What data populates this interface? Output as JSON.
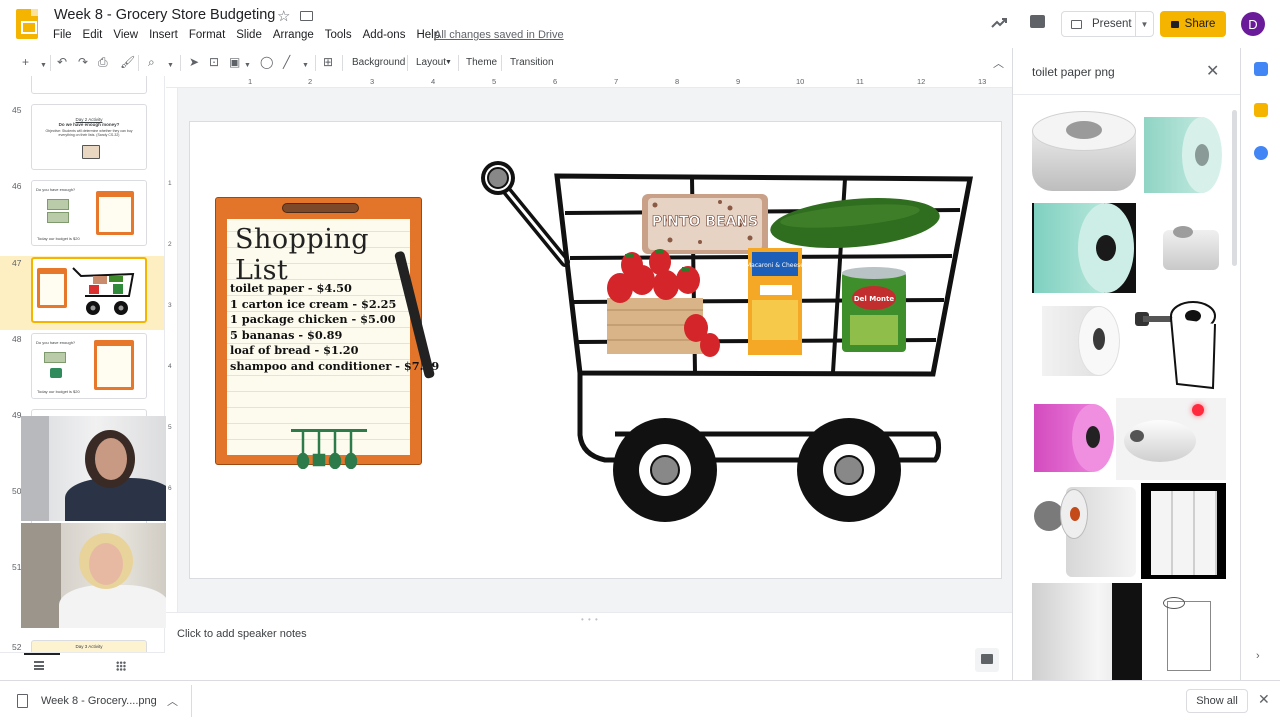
{
  "doc": {
    "title": "Week 8 - Grocery Store Budgeting",
    "saved_status": "All changes saved in Drive",
    "menus": [
      "File",
      "Edit",
      "View",
      "Insert",
      "Format",
      "Slide",
      "Arrange",
      "Tools",
      "Add-ons",
      "Help"
    ]
  },
  "header": {
    "present_label": "Present",
    "share_label": "Share",
    "avatar_letter": "D"
  },
  "toolbar": {
    "background_label": "Background",
    "layout_label": "Layout",
    "theme_label": "Theme",
    "transition_label": "Transition"
  },
  "ruler": {
    "top": [
      "1",
      "2",
      "3",
      "4",
      "5",
      "6",
      "7",
      "8",
      "9",
      "10",
      "11",
      "12",
      "13"
    ],
    "left": [
      "1",
      "2",
      "3",
      "4",
      "5",
      "6"
    ]
  },
  "filmstrip": {
    "slide_numbers": [
      "45",
      "46",
      "47",
      "48",
      "49",
      "50",
      "51",
      "52"
    ],
    "thumb45": {
      "title": "Day 2 Activity",
      "subtitle": "Do we have enough money?",
      "objective": "Objective: Students will determine whether they can buy everything on their lists. (Sandy CS-32)"
    },
    "thumb46": {
      "caption": "Do you have enough?",
      "footer": "Today our budget is $20"
    },
    "thumb48": {
      "caption": "Do you have enough?",
      "footer": "Today our budget is $20"
    },
    "thumb52": {
      "title": "Day 3 Activity"
    }
  },
  "slide": {
    "list_title": "Shopping List",
    "list_items": [
      "toilet paper - $4.50",
      "1 carton ice cream - $2.25",
      "1 package chicken - $5.00",
      "5 bananas - $0.89",
      "loaf of bread - $1.20",
      "shampoo and conditioner - $7.29"
    ],
    "beans_label": "PINTO BEANS",
    "mac_label": "Macaroni & Cheese",
    "can_label": "Del Monte"
  },
  "notes": {
    "placeholder": "Click to add speaker notes"
  },
  "side_panel": {
    "query": "toilet paper png",
    "result_count": 12
  },
  "download": {
    "file_name": "Week 8 - Grocery....png",
    "show_all_label": "Show all"
  },
  "colors": {
    "brand_yellow": "#f4b400",
    "avatar": "#6a1b9a",
    "clipboard_orange": "#e3752a",
    "selected_thumb_bg": "#feefc3"
  }
}
